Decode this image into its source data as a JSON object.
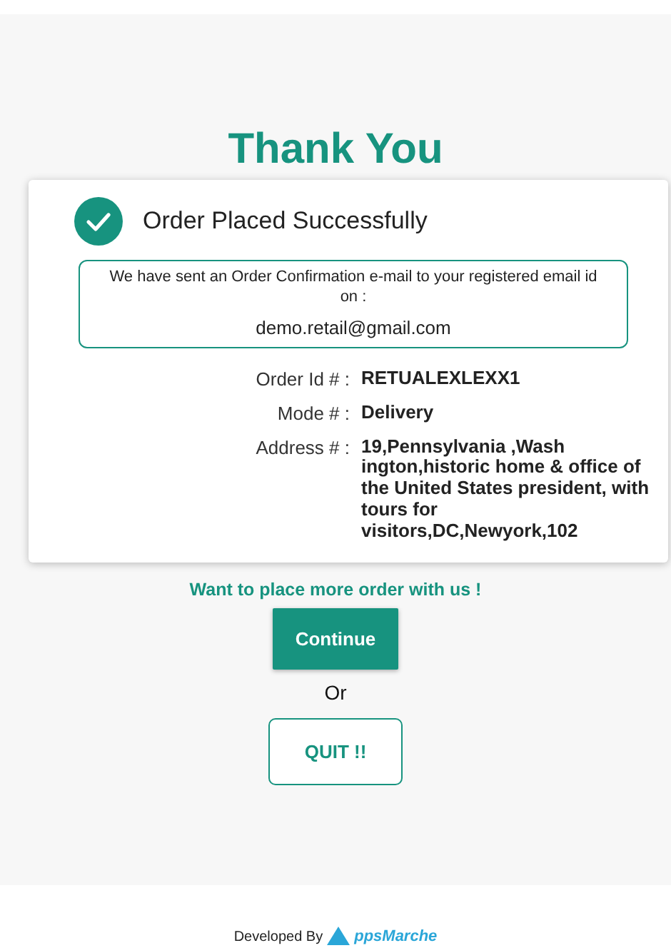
{
  "title": "Thank You",
  "status": {
    "kind": "success",
    "message": "Order Placed Successfully"
  },
  "notice": {
    "text": "We have sent an Order Confirmation e-mail to your registered email id on :",
    "email": "demo.retail@gmail.com"
  },
  "details": [
    {
      "label": "Order Id # :",
      "value": "RETUALEXLEXX1"
    },
    {
      "label": "Mode # :",
      "value": "Delivery"
    },
    {
      "label": "Address # :",
      "value": "19,Pennsylvania ,Wash ington,historic home & office of the United States president, with tours for visitors,DC,Newyork,102"
    }
  ],
  "prompt": "Want to place more order with us !",
  "buttons": [
    {
      "kind": "primary",
      "label": "Continue"
    },
    {
      "kind": "outline",
      "label": "QUIT !!"
    }
  ],
  "separator": "Or",
  "footer": {
    "text": "Developed By",
    "logo_text": "ppsMarche"
  }
}
